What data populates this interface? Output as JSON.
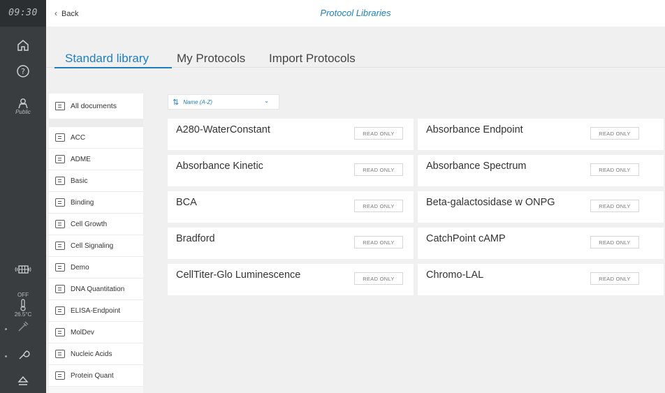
{
  "rail": {
    "time": "09:30",
    "user_label": "Public",
    "heater_state": "OFF",
    "heater_temp": "26.5°C"
  },
  "topbar": {
    "back_label": "Back",
    "title": "Protocol Libraries"
  },
  "tabs": [
    {
      "label": "Standard library",
      "active": true
    },
    {
      "label": "My Protocols",
      "active": false
    },
    {
      "label": "Import Protocols",
      "active": false
    }
  ],
  "folders": {
    "all_label": "All documents",
    "items": [
      "ACC",
      "ADME",
      "Basic",
      "Binding",
      "Cell Growth",
      "Cell Signaling",
      "Demo",
      "DNA Quantitation",
      "ELISA-Endpoint",
      "MolDev",
      "Nucleic Acids",
      "Protein Quant"
    ]
  },
  "sort": {
    "label": "Name (A-Z)"
  },
  "protocols": [
    {
      "name": "A280-WaterConstant",
      "badge": "READ ONLY"
    },
    {
      "name": "Absorbance Endpoint",
      "badge": "READ ONLY"
    },
    {
      "name": "Absorbance Kinetic",
      "badge": "READ ONLY"
    },
    {
      "name": "Absorbance Spectrum",
      "badge": "READ ONLY"
    },
    {
      "name": "BCA",
      "badge": "READ ONLY"
    },
    {
      "name": "Beta-galactosidase w ONPG",
      "badge": "READ ONLY"
    },
    {
      "name": "Bradford",
      "badge": "READ ONLY"
    },
    {
      "name": "CatchPoint cAMP",
      "badge": "READ ONLY"
    },
    {
      "name": "CellTiter-Glo Luminescence",
      "badge": "READ ONLY"
    },
    {
      "name": "Chromo-LAL",
      "badge": "READ ONLY"
    }
  ],
  "colors": {
    "accent": "#1e7fc0",
    "rail": "#3a3d3f"
  }
}
